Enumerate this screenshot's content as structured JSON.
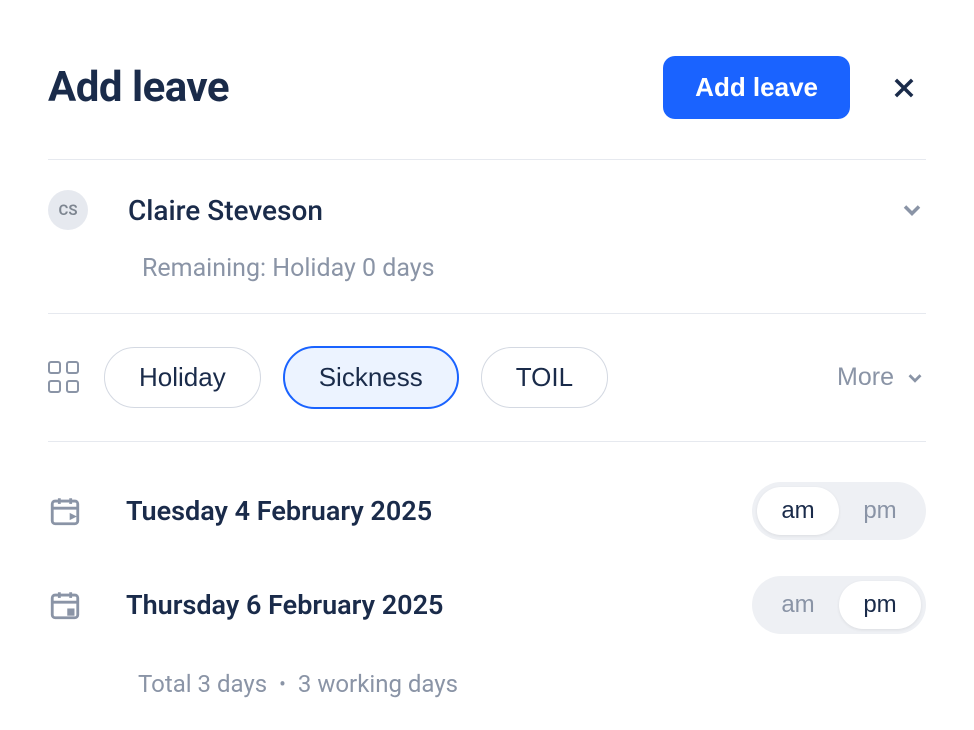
{
  "header": {
    "title": "Add leave",
    "actionButton": "Add leave"
  },
  "user": {
    "initials": "CS",
    "name": "Claire Steveson",
    "remaining": "Remaining: Holiday 0 days"
  },
  "leaveTypes": {
    "options": [
      "Holiday",
      "Sickness",
      "TOIL"
    ],
    "selected": "Sickness",
    "more": "More"
  },
  "dates": {
    "start": {
      "label": "Tuesday 4 February 2025",
      "am": "am",
      "pm": "pm",
      "active": "am"
    },
    "end": {
      "label": "Thursday 6 February 2025",
      "am": "am",
      "pm": "pm",
      "active": "pm"
    },
    "totalDays": "Total 3 days",
    "workingDays": "3 working days"
  }
}
